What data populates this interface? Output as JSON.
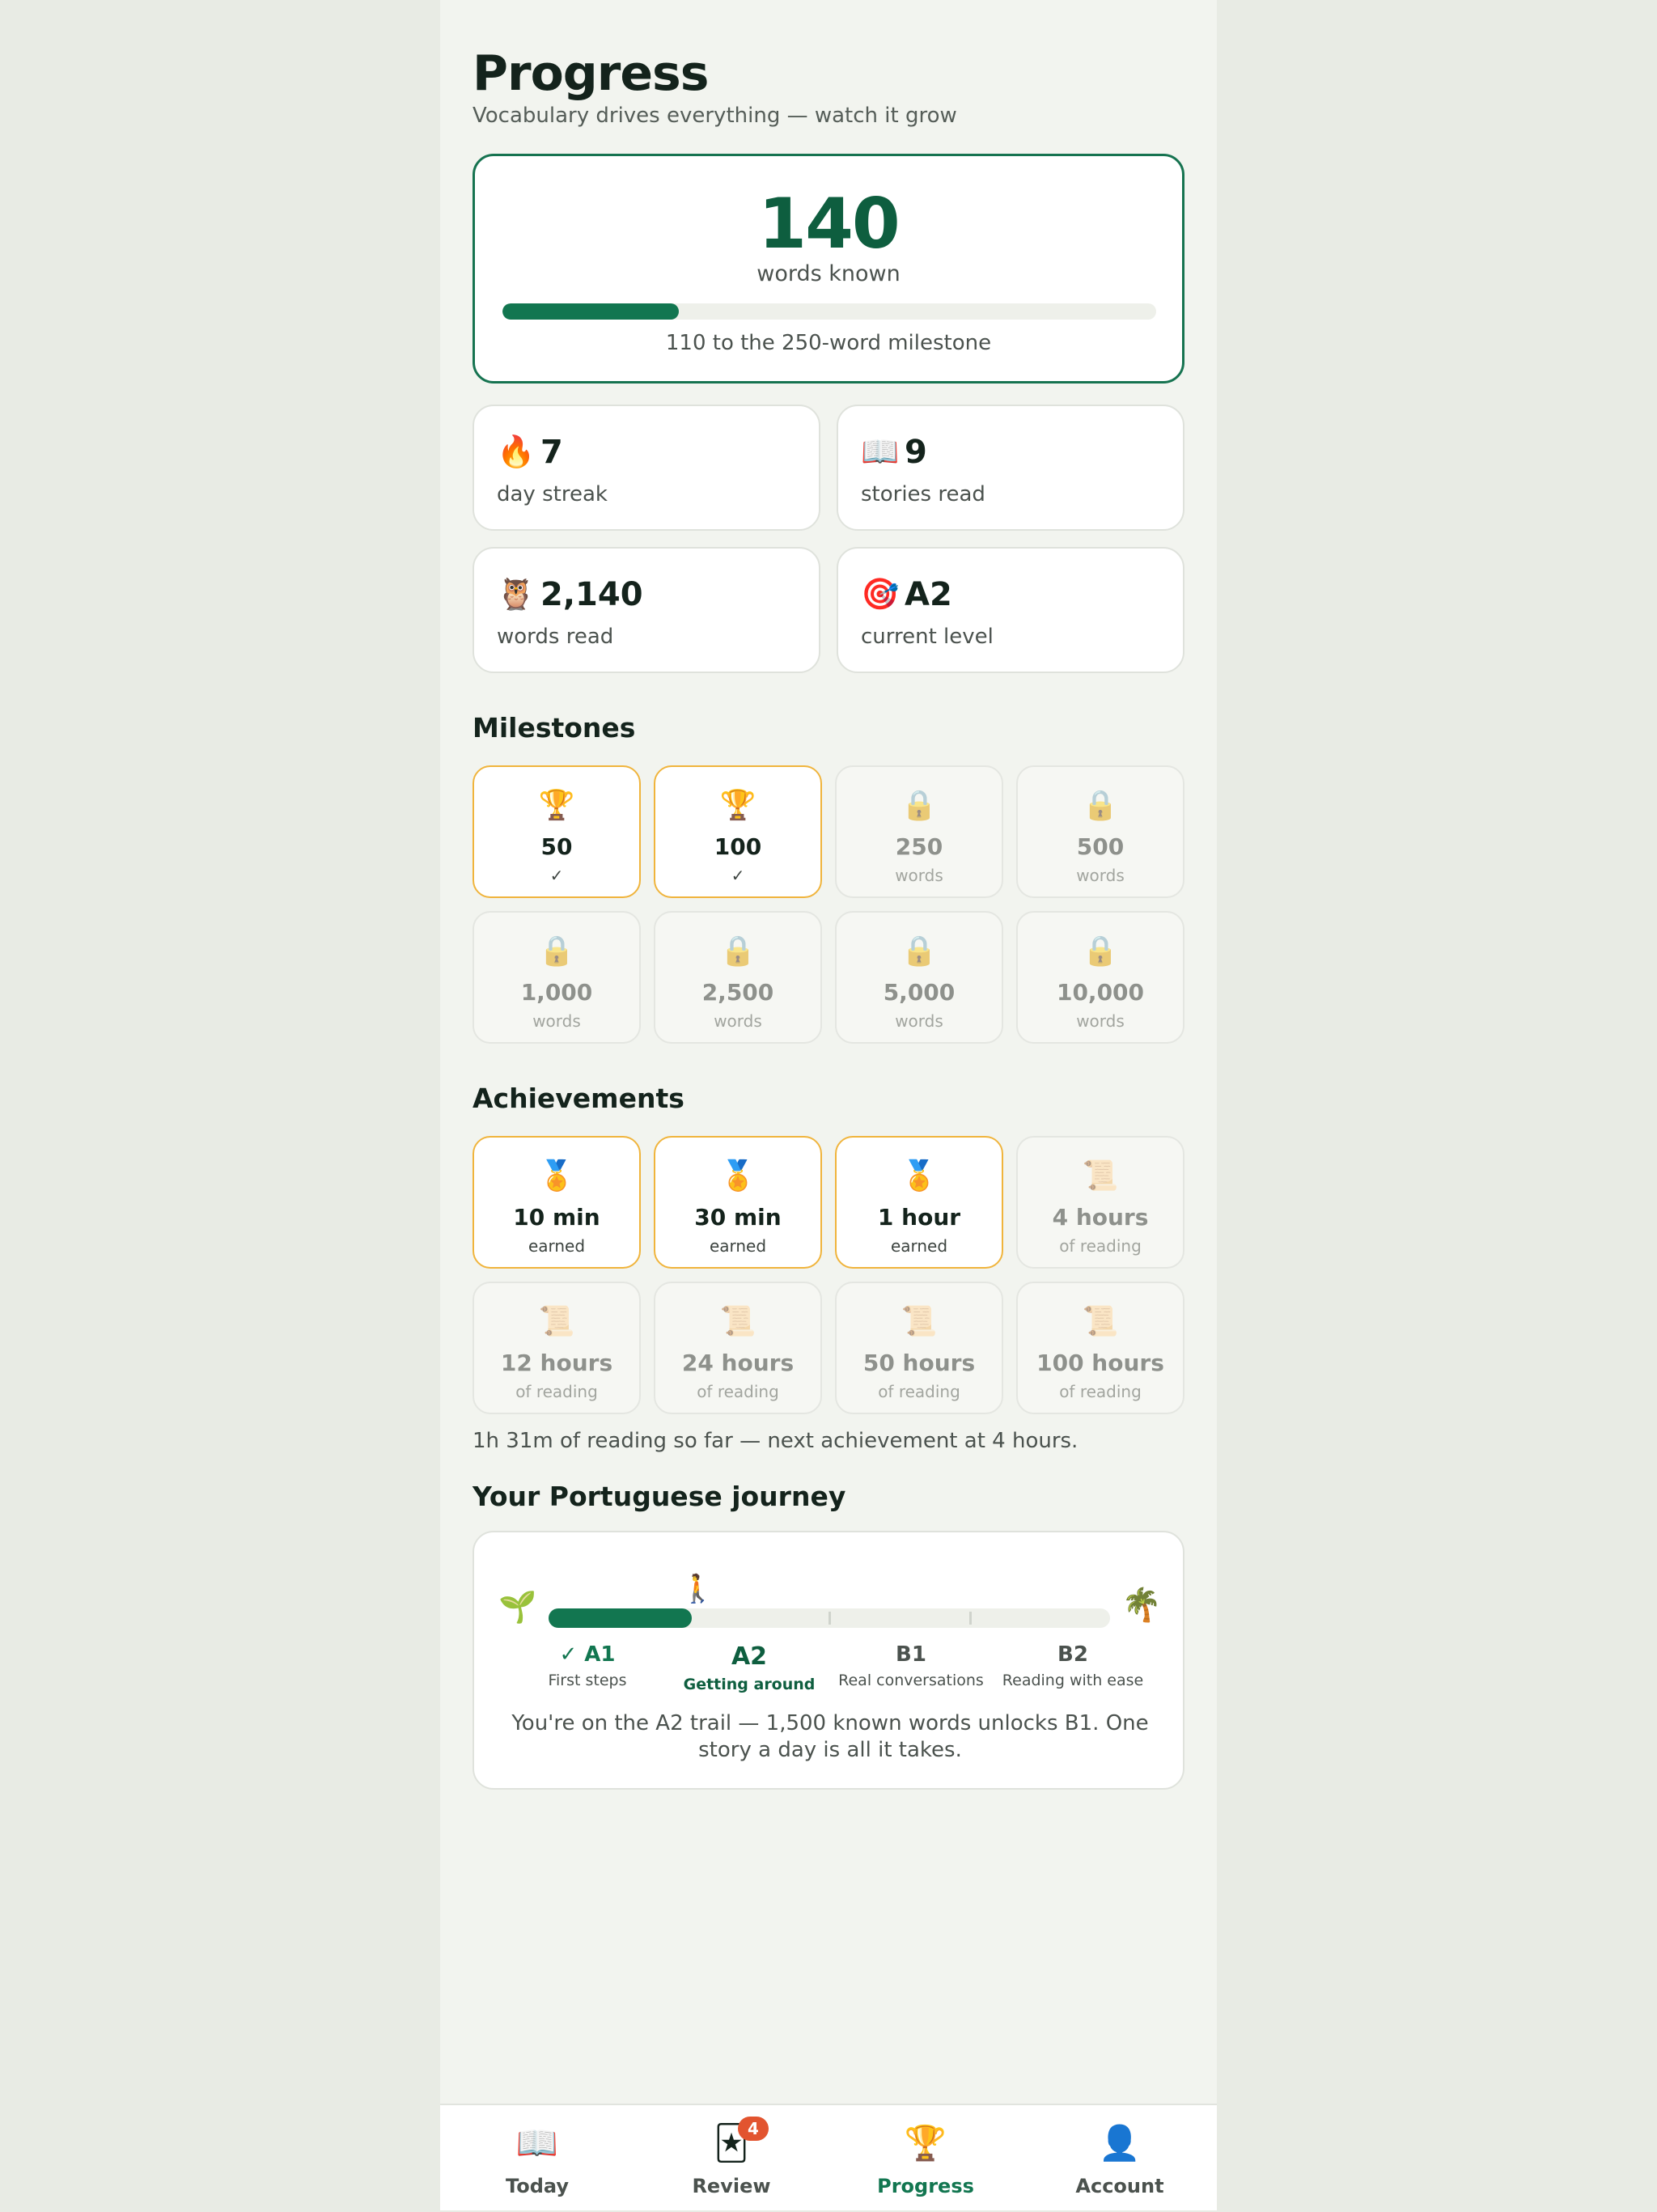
{
  "header": {
    "title": "Progress",
    "subtitle": "Vocabulary drives everything — watch it grow"
  },
  "hero": {
    "count": "140",
    "label": "words known",
    "progress_fraction": 0.27,
    "note": "110 to the 250-word milestone"
  },
  "stats": [
    {
      "icon": "🔥",
      "icon_name": "fire-icon",
      "value": "7",
      "label": "day streak"
    },
    {
      "icon": "📖",
      "icon_name": "open-book-icon",
      "value": "9",
      "label": "stories read"
    },
    {
      "icon": "🦉",
      "icon_name": "owl-icon",
      "value": "2,140",
      "label": "words read"
    },
    {
      "icon": "🎯",
      "icon_name": "target-icon",
      "value": "A2",
      "label": "current level"
    }
  ],
  "milestones": {
    "title": "Milestones",
    "items": [
      {
        "icon": "🏆",
        "value": "50",
        "sub": "✓",
        "earned": true
      },
      {
        "icon": "🏆",
        "value": "100",
        "sub": "✓",
        "earned": true
      },
      {
        "icon": "🔒",
        "value": "250",
        "sub": "words",
        "earned": false
      },
      {
        "icon": "🔒",
        "value": "500",
        "sub": "words",
        "earned": false
      },
      {
        "icon": "🔒",
        "value": "1,000",
        "sub": "words",
        "earned": false
      },
      {
        "icon": "🔒",
        "value": "2,500",
        "sub": "words",
        "earned": false
      },
      {
        "icon": "🔒",
        "value": "5,000",
        "sub": "words",
        "earned": false
      },
      {
        "icon": "🔒",
        "value": "10,000",
        "sub": "words",
        "earned": false
      }
    ]
  },
  "achievements": {
    "title": "Achievements",
    "items": [
      {
        "icon": "🏅",
        "value": "10 min",
        "sub": "earned",
        "earned": true
      },
      {
        "icon": "🏅",
        "value": "30 min",
        "sub": "earned",
        "earned": true
      },
      {
        "icon": "🏅",
        "value": "1 hour",
        "sub": "earned",
        "earned": true
      },
      {
        "icon": "📜",
        "value": "4 hours",
        "sub": "of reading",
        "earned": false
      },
      {
        "icon": "📜",
        "value": "12 hours",
        "sub": "of reading",
        "earned": false
      },
      {
        "icon": "📜",
        "value": "24 hours",
        "sub": "of reading",
        "earned": false
      },
      {
        "icon": "📜",
        "value": "50 hours",
        "sub": "of reading",
        "earned": false
      },
      {
        "icon": "📜",
        "value": "100 hours",
        "sub": "of reading",
        "earned": false
      }
    ],
    "note": "1h 31m of reading so far — next achievement at 4 hours."
  },
  "journey": {
    "title": "Your Portuguese journey",
    "start_icon": "🌱",
    "end_icon": "🌴",
    "walker_icon": "🚶",
    "progress_fraction": 0.255,
    "stages": [
      {
        "code": "✓ A1",
        "desc": "First steps",
        "state": "done"
      },
      {
        "code": "A2",
        "desc": "Getting around",
        "state": "current"
      },
      {
        "code": "B1",
        "desc": "Real conversations",
        "state": "upcoming"
      },
      {
        "code": "B2",
        "desc": "Reading with ease",
        "state": "upcoming"
      }
    ],
    "message": "You're on the A2 trail — 1,500 known words unlocks B1. One story a day is all it takes."
  },
  "nav": {
    "items": [
      {
        "icon": "📖",
        "icon_name": "book-icon",
        "label": "Today",
        "active": false
      },
      {
        "icon": "🃏",
        "icon_name": "cards-icon",
        "label": "Review",
        "active": false,
        "badge": "4"
      },
      {
        "icon": "🏆",
        "icon_name": "trophy-icon",
        "label": "Progress",
        "active": true
      },
      {
        "icon": "👤",
        "icon_name": "person-icon",
        "label": "Account",
        "active": false
      }
    ]
  },
  "colors": {
    "accent": "#127650",
    "earned_border": "#f0b43c",
    "badge": "#e2542f"
  }
}
